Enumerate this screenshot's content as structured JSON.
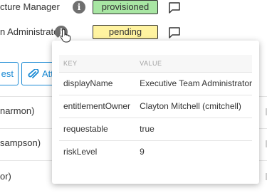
{
  "rows": [
    {
      "label": "cture Manager",
      "status": "provisioned"
    },
    {
      "label": "n Administrator",
      "status": "pending"
    }
  ],
  "buttons": {
    "left_partial": "est",
    "attach_partial": "Att"
  },
  "list_rows": [
    {
      "label": "narmon)"
    },
    {
      "label": "sampson)"
    },
    {
      "label": "or)"
    }
  ],
  "popover": {
    "headers": {
      "key": "KEY",
      "value": "VALUE"
    },
    "entries": [
      {
        "key": "displayName",
        "value": "Executive Team Administrator"
      },
      {
        "key": "entitlementOwner",
        "value": "Clayton Mitchell (cmitchell)"
      },
      {
        "key": "requestable",
        "value": "true"
      },
      {
        "key": "riskLevel",
        "value": "9"
      }
    ]
  },
  "icons": {
    "info": "info-icon",
    "comment": "comment-icon",
    "attach": "paperclip-icon",
    "cursor": "hand-pointer-icon"
  },
  "colors": {
    "provisioned_bg": "#a8e6a3",
    "pending_bg": "#fff3a0",
    "accent": "#1a8ad4"
  }
}
